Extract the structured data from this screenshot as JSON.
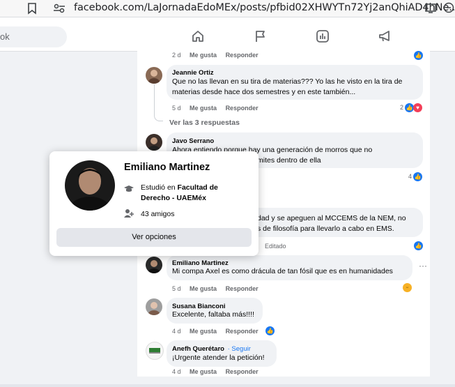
{
  "browser": {
    "url": "facebook.com/LaJornadaEdoMEx/posts/pfbid02XHWYTn72Yj2anQhiAD4hNe..."
  },
  "nav": {
    "search_fragment": "ok"
  },
  "comments": [
    {
      "time": "2 d",
      "like": "Me gusta",
      "reply": "Responder"
    },
    {
      "author": "Jeannie Ortiz",
      "text1": "Que no las llevan en su tira de materias??? Yo las he visto en la tira de",
      "text2": "materias desde hace dos semestres y en este también...",
      "time": "5 d",
      "like": "Me gusta",
      "reply": "Responder",
      "reaction_count": "2"
    },
    {
      "view_replies": "Ver las 3 respuestas"
    },
    {
      "author": "Javo Serrano",
      "text1": "Ahora entiendo porque hay una generación de morros que no",
      "text2": "mites dentro de ella",
      "reaction_count": "4"
    },
    {
      "text1": "dad y se apeguen al MCCEMS de la NEM, no",
      "text2": "s de filosofía para llevarlo a cabo en EMS.",
      "edited": "Editado"
    },
    {
      "author": "Emiliano Martinez",
      "text1": "Mi compa Axel es como drácula de tan fósil que es en humanidades",
      "time": "5 d",
      "like": "Me gusta",
      "reply": "Responder"
    },
    {
      "author": "Susana Bianconi",
      "text1": "Excelente, faltaba más!!!!",
      "time": "4 d",
      "like": "Me gusta",
      "reply": "Responder"
    },
    {
      "author": "Anefh Querétaro",
      "follow": "· Seguir",
      "text1": "¡Urgente atender la petición!",
      "time": "4 d",
      "like": "Me gusta",
      "reply": "Responder"
    }
  ],
  "hovercard": {
    "name": "Emiliano Martinez",
    "study_prefix": "Estudió en ",
    "study_place1": "Facultad de",
    "study_place2": "Derecho - UAEMéx",
    "friends": "43 amigos",
    "button": "Ver opciones"
  },
  "colors": {
    "accent": "#1877f2",
    "panel": "#ffffff",
    "bubble": "#f0f2f5"
  }
}
